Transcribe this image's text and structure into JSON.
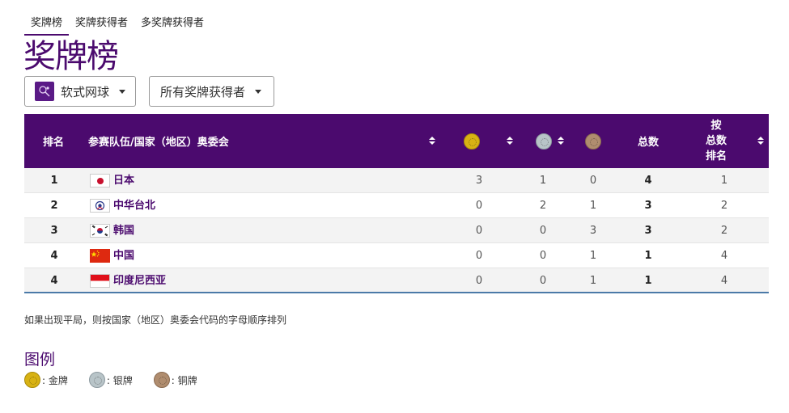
{
  "tabs": [
    "奖牌榜",
    "奖牌获得者",
    "多奖牌获得者"
  ],
  "page_title": "奖牌榜",
  "filters": {
    "sport": "软式网球",
    "medalist": "所有奖牌获得者"
  },
  "table": {
    "header": {
      "rank": "排名",
      "team": "参赛队伍/国家（地区）奥委会",
      "total": "总数",
      "rank_by_total": [
        "按",
        "总数",
        "排名"
      ]
    },
    "rows": [
      {
        "rank": "1",
        "country": "日本",
        "gold": "3",
        "silver": "1",
        "bronze": "0",
        "total": "4",
        "rank_by_total": "1"
      },
      {
        "rank": "2",
        "country": "中华台北",
        "gold": "0",
        "silver": "2",
        "bronze": "1",
        "total": "3",
        "rank_by_total": "2"
      },
      {
        "rank": "3",
        "country": "韩国",
        "gold": "0",
        "silver": "0",
        "bronze": "3",
        "total": "3",
        "rank_by_total": "2"
      },
      {
        "rank": "4",
        "country": "中国",
        "gold": "0",
        "silver": "0",
        "bronze": "1",
        "total": "1",
        "rank_by_total": "4"
      },
      {
        "rank": "4",
        "country": "印度尼西亚",
        "gold": "0",
        "silver": "0",
        "bronze": "1",
        "total": "1",
        "rank_by_total": "4"
      }
    ]
  },
  "note": "如果出现平局，则按国家（地区）奥委会代码的字母顺序排列",
  "legend": {
    "title": "图例",
    "gold": ": 金牌",
    "silver": ": 银牌",
    "bronze": ": 铜牌"
  },
  "colors": {
    "brand": "#4b0a6e",
    "gold": "#d8b214",
    "silver": "#b8c4c8",
    "bronze": "#b08d6f"
  }
}
